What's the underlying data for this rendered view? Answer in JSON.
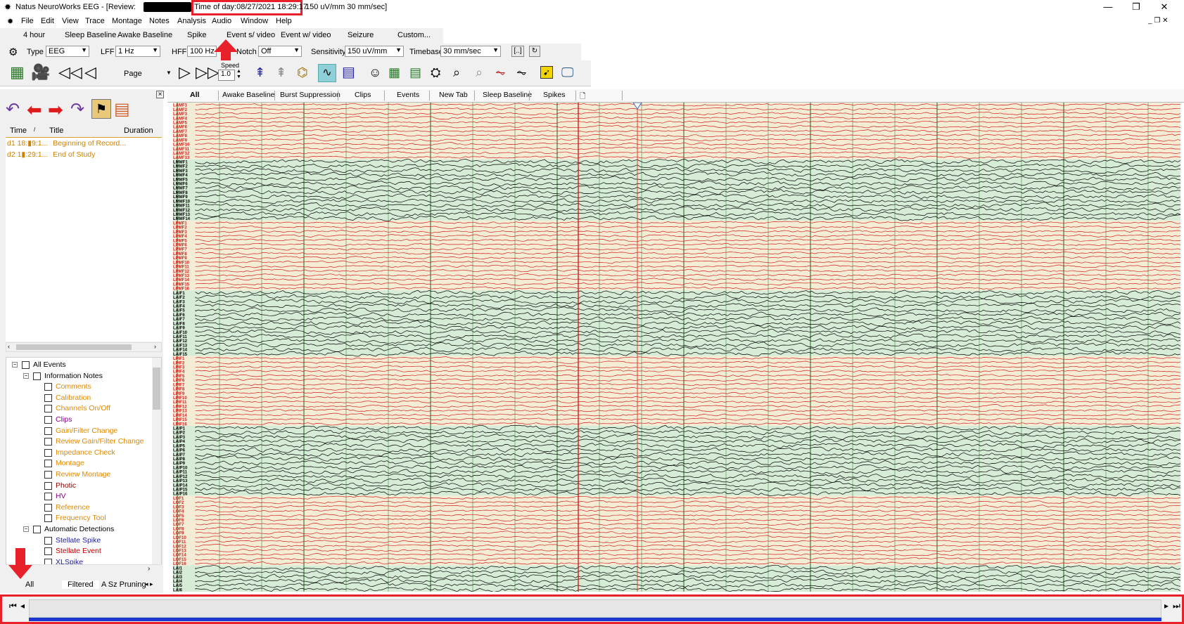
{
  "window": {
    "title": "Natus NeuroWorks EEG - [Review:",
    "time_of_day": "Time of day:08/27/2021 18:29:17",
    "title_extra": "150 uV/mm   30 mm/sec]",
    "controls": [
      "—",
      "❐",
      "✕"
    ]
  },
  "menu": [
    "File",
    "Edit",
    "View",
    "Trace",
    "Montage",
    "Notes",
    "Analysis",
    "Audio",
    "Window",
    "Help"
  ],
  "protocols": [
    "4 hour",
    "Sleep Baseline",
    "Awake Baseline",
    "Spike",
    "Event s/ video",
    "Event w/ video",
    "Seizure",
    "Custom..."
  ],
  "settings": {
    "type_label": "Type",
    "type_value": "EEG",
    "lff_label": "LFF",
    "lff_value": "1 Hz",
    "hff_label": "HFF",
    "hff_value": "100 Hz",
    "notch_label": "Notch",
    "notch_value": "Off",
    "sensitivity_label": "Sensitivity",
    "sensitivity_value": "150 uV/mm",
    "timebase_label": "Timebase",
    "timebase_value": "30 mm/sec",
    "bracket_button": "[..]"
  },
  "toolbar": {
    "page_label": "Page",
    "speed_label": "Speed",
    "speed_value": "1.0"
  },
  "events_panel": {
    "col_time": "Time",
    "col_title": "Title",
    "col_duration": "Duration",
    "rows": [
      {
        "time": "d1 18:▮9:1...",
        "title": "Beginning of Record..."
      },
      {
        "time": "d2 1▮:29:1...",
        "title": "End of Study"
      }
    ]
  },
  "tree": [
    {
      "label": "All Events",
      "level": 0,
      "color": "#000000"
    },
    {
      "label": "Information Notes",
      "level": 1,
      "color": "#000000"
    },
    {
      "label": "Comments",
      "level": 2,
      "color": "#e08a00"
    },
    {
      "label": "Calibration",
      "level": 2,
      "color": "#e08a00"
    },
    {
      "label": "Channels On/Off",
      "level": 2,
      "color": "#e08a00"
    },
    {
      "label": "Clips",
      "level": 2,
      "color": "#8a008a"
    },
    {
      "label": "Gain/Filter Change",
      "level": 2,
      "color": "#e08a00"
    },
    {
      "label": "Review Gain/Filter Change",
      "level": 2,
      "color": "#e08a00"
    },
    {
      "label": "Impedance Check",
      "level": 2,
      "color": "#e08a00"
    },
    {
      "label": "Montage",
      "level": 2,
      "color": "#e08a00"
    },
    {
      "label": "Review Montage",
      "level": 2,
      "color": "#e08a00"
    },
    {
      "label": "Photic",
      "level": 2,
      "color": "#8a0000"
    },
    {
      "label": "HV",
      "level": 2,
      "color": "#8a008a"
    },
    {
      "label": "Reference",
      "level": 2,
      "color": "#e08a00"
    },
    {
      "label": "Frequency Tool",
      "level": 2,
      "color": "#e08a00"
    },
    {
      "label": "Automatic Detections",
      "level": 1,
      "color": "#000000"
    },
    {
      "label": "Stellate Spike",
      "level": 2,
      "color": "#1a1aa0"
    },
    {
      "label": "Stellate Event",
      "level": 2,
      "color": "#c00000"
    },
    {
      "label": "XLSpike",
      "level": 2,
      "color": "#1a1aa0"
    }
  ],
  "bottom_tabs": [
    "All",
    "Filtered",
    "A Sz Pruning"
  ],
  "eeg_tabs": [
    "All",
    "Awake Baseline",
    "Burst Suppression",
    "Clips",
    "Events",
    "New Tab",
    "Sleep Baseline",
    "Spikes"
  ],
  "channel_groups": [
    {
      "prefix": "LAMF",
      "count": 13,
      "color": "#d22020",
      "bg": "#f4ecd4"
    },
    {
      "prefix": "LMMF",
      "count": 14,
      "color": "#000000",
      "bg": "#d6ecd6"
    },
    {
      "prefix": "LPMF",
      "count": 16,
      "color": "#d22020",
      "bg": "#f4ecd4"
    },
    {
      "prefix": "LAIF",
      "count": 15,
      "color": "#000000",
      "bg": "#d6ecd6"
    },
    {
      "prefix": "LPIF",
      "count": 16,
      "color": "#d22020",
      "bg": "#f4ecd4"
    },
    {
      "prefix": "LAIP",
      "count": 16,
      "color": "#000000",
      "bg": "#d6ecd6"
    },
    {
      "prefix": "LOF",
      "count": 16,
      "color": "#d22020",
      "bg": "#f4ecd4"
    },
    {
      "prefix": "LAI",
      "count": 6,
      "color": "#000000",
      "bg": "#d6ecd6"
    }
  ],
  "colors": {
    "highlight_red": "#e8202a",
    "timeline_blue": "#1836d0",
    "grid_green": "#2e8b2e",
    "event_red": "#d81b1b"
  }
}
